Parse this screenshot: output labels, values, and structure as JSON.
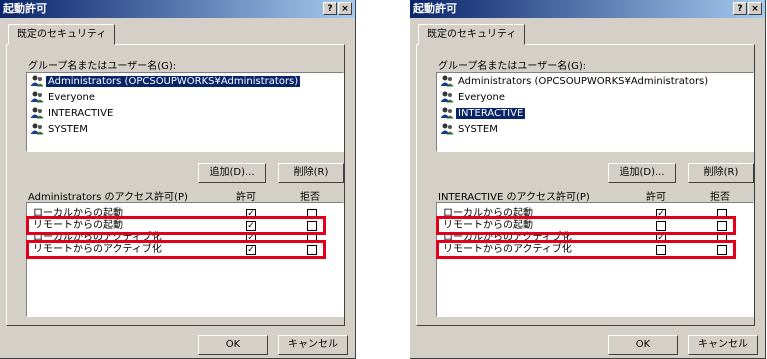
{
  "dialogs": [
    {
      "title": "起動許可",
      "help_btn": "?",
      "close_btn": "×",
      "tab": "既定のセキュリティ",
      "group_label": "グループ名またはユーザー名(G):",
      "users": [
        {
          "name": "Administrators (OPCSOUPWORKS¥Administrators)",
          "selected": true
        },
        {
          "name": "Everyone",
          "selected": false
        },
        {
          "name": "INTERACTIVE",
          "selected": false
        },
        {
          "name": "SYSTEM",
          "selected": false
        }
      ],
      "add_button": "追加(D)...",
      "remove_button": "削除(R)",
      "perm_label": "Administrators のアクセス許可(P)",
      "allow_header": "許可",
      "deny_header": "拒否",
      "permissions": [
        {
          "name": "ローカルからの起動",
          "allow": true,
          "deny": false
        },
        {
          "name": "リモートからの起動",
          "allow": true,
          "deny": false
        },
        {
          "name": "ローカルからのアクティブ化",
          "allow": true,
          "deny": false
        },
        {
          "name": "リモートからのアクティブ化",
          "allow": true,
          "deny": false
        }
      ],
      "ok_button": "OK",
      "cancel_button": "キャンセル",
      "highlight_color": "#e0001b"
    },
    {
      "title": "起動許可",
      "help_btn": "?",
      "close_btn": "×",
      "tab": "既定のセキュリティ",
      "group_label": "グループ名またはユーザー名(G):",
      "users": [
        {
          "name": "Administrators (OPCSOUPWORKS¥Administrators)",
          "selected": false
        },
        {
          "name": "Everyone",
          "selected": false
        },
        {
          "name": "INTERACTIVE",
          "selected": true
        },
        {
          "name": "SYSTEM",
          "selected": false
        }
      ],
      "add_button": "追加(D)...",
      "remove_button": "削除(R)",
      "perm_label": "INTERACTIVE のアクセス許可(P)",
      "allow_header": "許可",
      "deny_header": "拒否",
      "permissions": [
        {
          "name": "ローカルからの起動",
          "allow": true,
          "deny": false
        },
        {
          "name": "リモートからの起動",
          "allow": false,
          "deny": false
        },
        {
          "name": "ローカルからのアクティブ化",
          "allow": true,
          "deny": false
        },
        {
          "name": "リモートからのアクティブ化",
          "allow": false,
          "deny": false
        }
      ],
      "ok_button": "OK",
      "cancel_button": "キャンセル",
      "highlight_color": "#e0001b"
    }
  ]
}
